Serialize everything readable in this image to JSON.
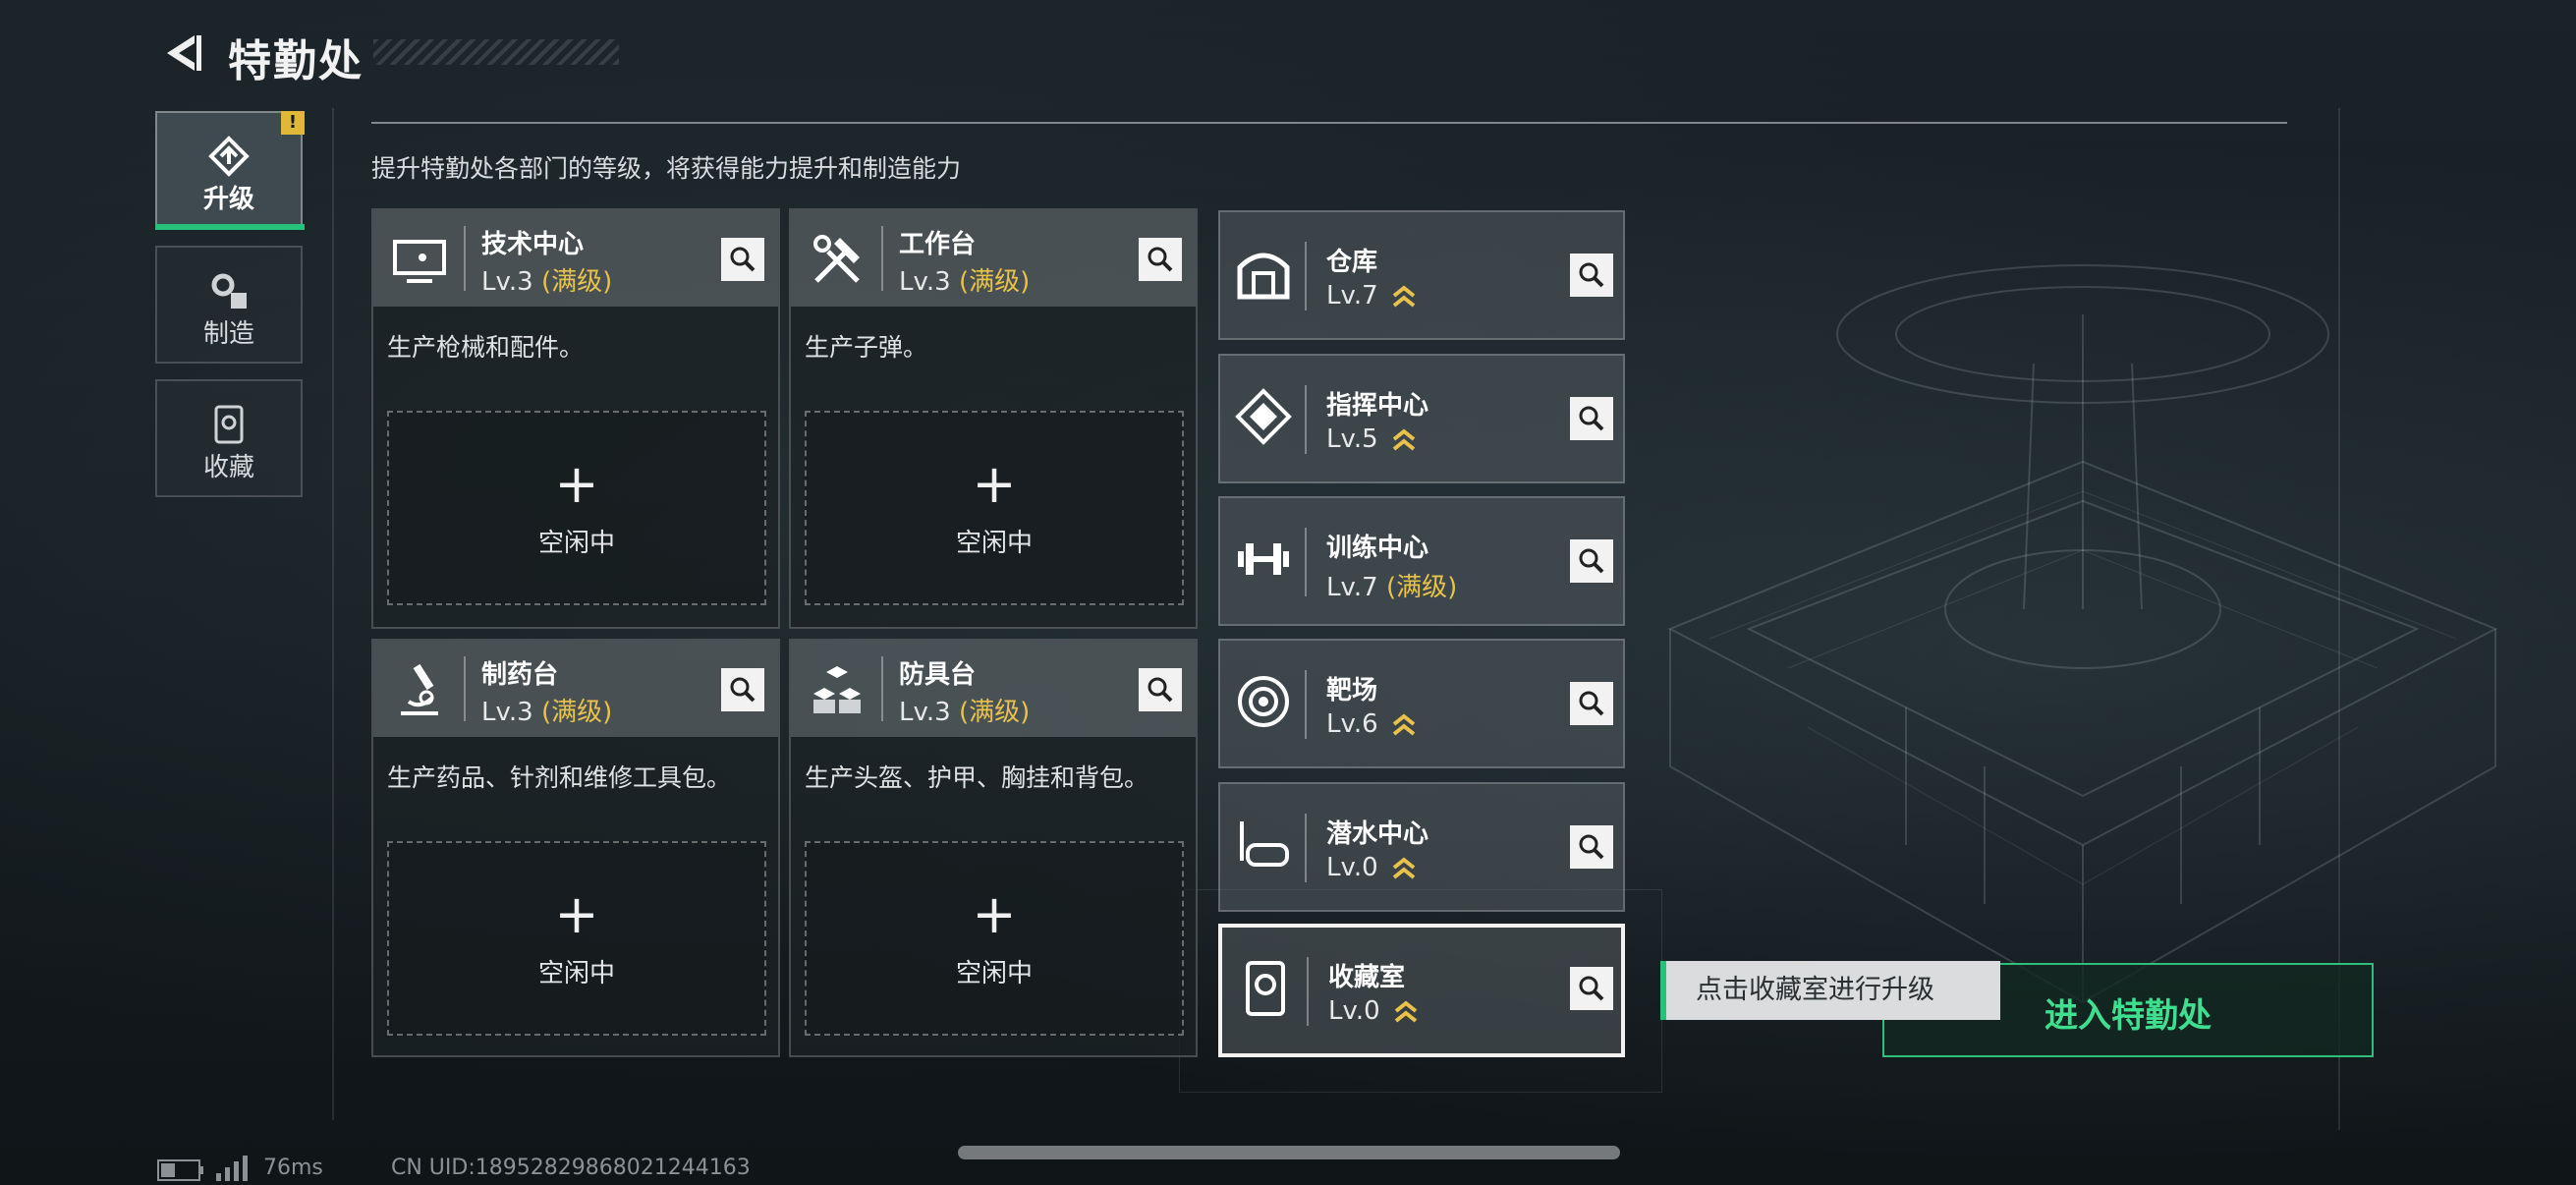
{
  "header": {
    "title": "特勤处"
  },
  "nav": [
    {
      "label": "升级",
      "badge": "!"
    },
    {
      "label": "制造"
    },
    {
      "label": "收藏"
    }
  ],
  "main": {
    "description": "提升特勤处各部门的等级，将获得能力提升和制造能力"
  },
  "icons": {
    "plus": "+"
  },
  "facilities": [
    {
      "name": "技术中心",
      "level": "Lv.3",
      "status": "(满级)",
      "desc": "生产枪械和配件。",
      "slot": "空闲中"
    },
    {
      "name": "工作台",
      "level": "Lv.3",
      "status": "(满级)",
      "desc": "生产子弹。",
      "slot": "空闲中"
    },
    {
      "name": "制药台",
      "level": "Lv.3",
      "status": "(满级)",
      "desc": "生产药品、针剂和维修工具包。",
      "slot": "空闲中"
    },
    {
      "name": "防具台",
      "level": "Lv.3",
      "status": "(满级)",
      "desc": "生产头盔、护甲、胸挂和背包。",
      "slot": "空闲中"
    }
  ],
  "upgrades": [
    {
      "name": "仓库",
      "level": "Lv.7",
      "upgradable": true
    },
    {
      "name": "指挥中心",
      "level": "Lv.5",
      "upgradable": true
    },
    {
      "name": "训练中心",
      "level": "Lv.7",
      "status": "(满级)"
    },
    {
      "name": "靶场",
      "level": "Lv.6",
      "upgradable": true
    },
    {
      "name": "潜水中心",
      "level": "Lv.0",
      "upgradable": true
    },
    {
      "name": "收藏室",
      "level": "Lv.0",
      "upgradable": true,
      "selected": true
    }
  ],
  "actions": {
    "enter_label": "进入特勤处",
    "tooltip": "点击收藏室进行升级"
  },
  "status": {
    "ping": "76ms",
    "uid": "CN UID:18952829868021244163"
  },
  "colors": {
    "accent_green": "#27c27a",
    "max_level_gold": "#e8c24a",
    "background": "#141b1f"
  }
}
